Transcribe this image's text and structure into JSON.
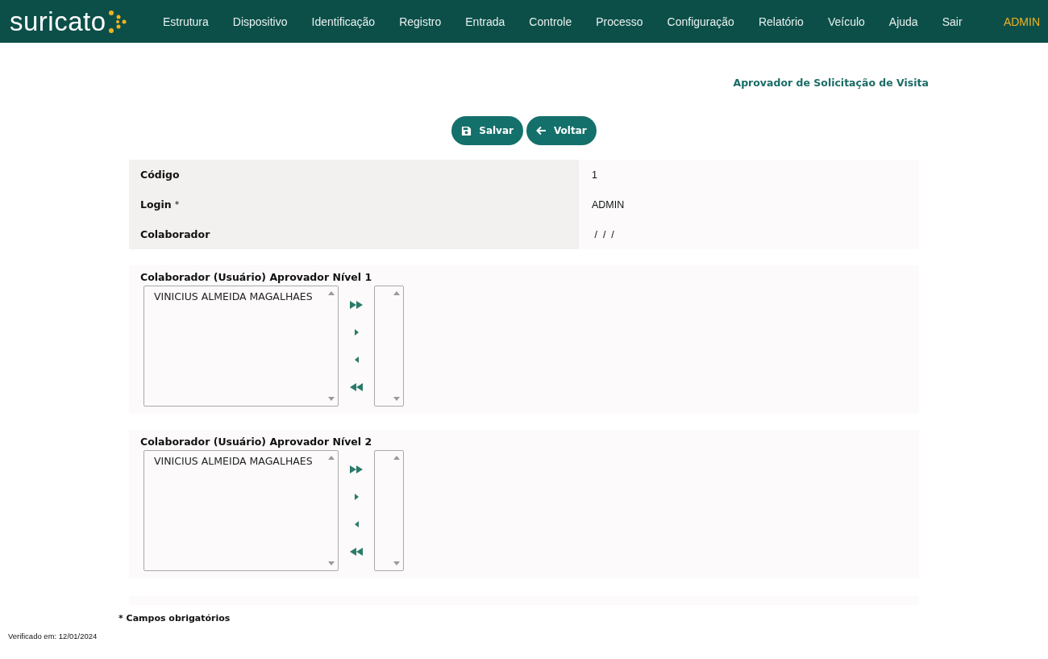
{
  "brand": {
    "name": "suricato"
  },
  "nav": [
    "Estrutura",
    "Dispositivo",
    "Identificação",
    "Registro",
    "Entrada",
    "Controle",
    "Processo",
    "Configuração",
    "Relatório",
    "Veículo",
    "Ajuda",
    "Sair"
  ],
  "user": "ADMIN",
  "page_title": "Aprovador de Solicitação de Visita",
  "buttons": [
    {
      "kind": "save",
      "label": "Salvar"
    },
    {
      "kind": "back",
      "label": "Voltar"
    }
  ],
  "fields": [
    {
      "label": "Código",
      "value": "1"
    },
    {
      "label": "Login",
      "required_mark": "*",
      "value": "ADMIN"
    },
    {
      "label": "Colaborador",
      "value": " /  /  /"
    }
  ],
  "approver_levels": [
    {
      "label": "Colaborador (Usuário) Aprovador Nível 1",
      "available": [
        "VINICIUS ALMEIDA MAGALHAES"
      ]
    },
    {
      "label": "Colaborador (Usuário) Aprovador Nível 2",
      "available": [
        "VINICIUS ALMEIDA MAGALHAES"
      ]
    }
  ],
  "required_note": "* Campos obrigatórios",
  "verified": "Verificado em: 12/01/2024"
}
